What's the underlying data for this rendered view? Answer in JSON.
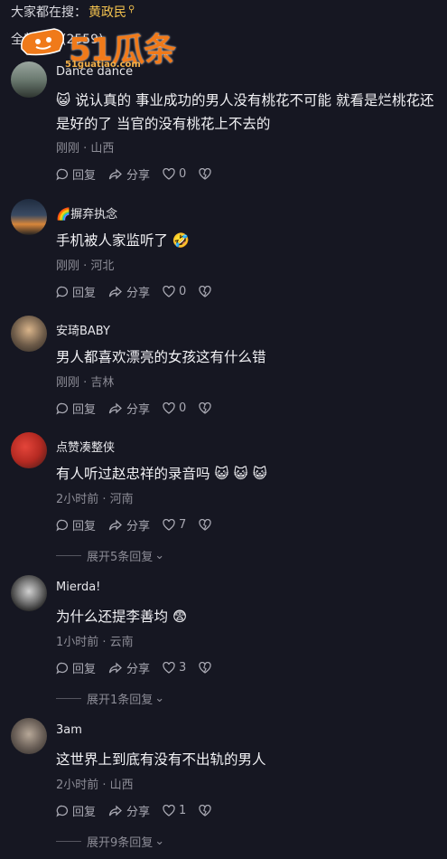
{
  "top": {
    "prefix": "大家都在搜：",
    "keyword": "黄政民",
    "comment_count": "全部评论(2559)"
  },
  "watermark": {
    "brand": "51瓜条",
    "url": "51guatiao.com"
  },
  "actions": {
    "reply": "回复",
    "share": "分享"
  },
  "comments": [
    {
      "user": "Dance dance",
      "text": "😺 说认真的 事业成功的男人没有桃花不可能 就看是烂桃花还是好的了 当官的没有桃花上不去的",
      "meta": "刚刚 · 山西",
      "likes": "0",
      "expand": ""
    },
    {
      "user": "🌈摒弃执念",
      "text": "手机被人家监听了 🤣",
      "meta": "刚刚 · 河北",
      "likes": "0",
      "expand": ""
    },
    {
      "user": "安琦BABY",
      "text": "男人都喜欢漂亮的女孩这有什么错",
      "meta": "刚刚 · 吉林",
      "likes": "0",
      "expand": ""
    },
    {
      "user": "点赞凑整侠",
      "text": "有人听过赵忠祥的录音吗 😺 😺 😺",
      "meta": "2小时前 · 河南",
      "likes": "7",
      "expand": "展开5条回复"
    },
    {
      "user": "Mierda!",
      "text": "为什么还提李善均 😨",
      "meta": "1小时前 · 云南",
      "likes": "3",
      "expand": "展开1条回复"
    },
    {
      "user": "3am",
      "text": "这世界上到底有没有不出轨的男人",
      "meta": "2小时前 · 山西",
      "likes": "1",
      "expand": "展开9条回复"
    }
  ]
}
